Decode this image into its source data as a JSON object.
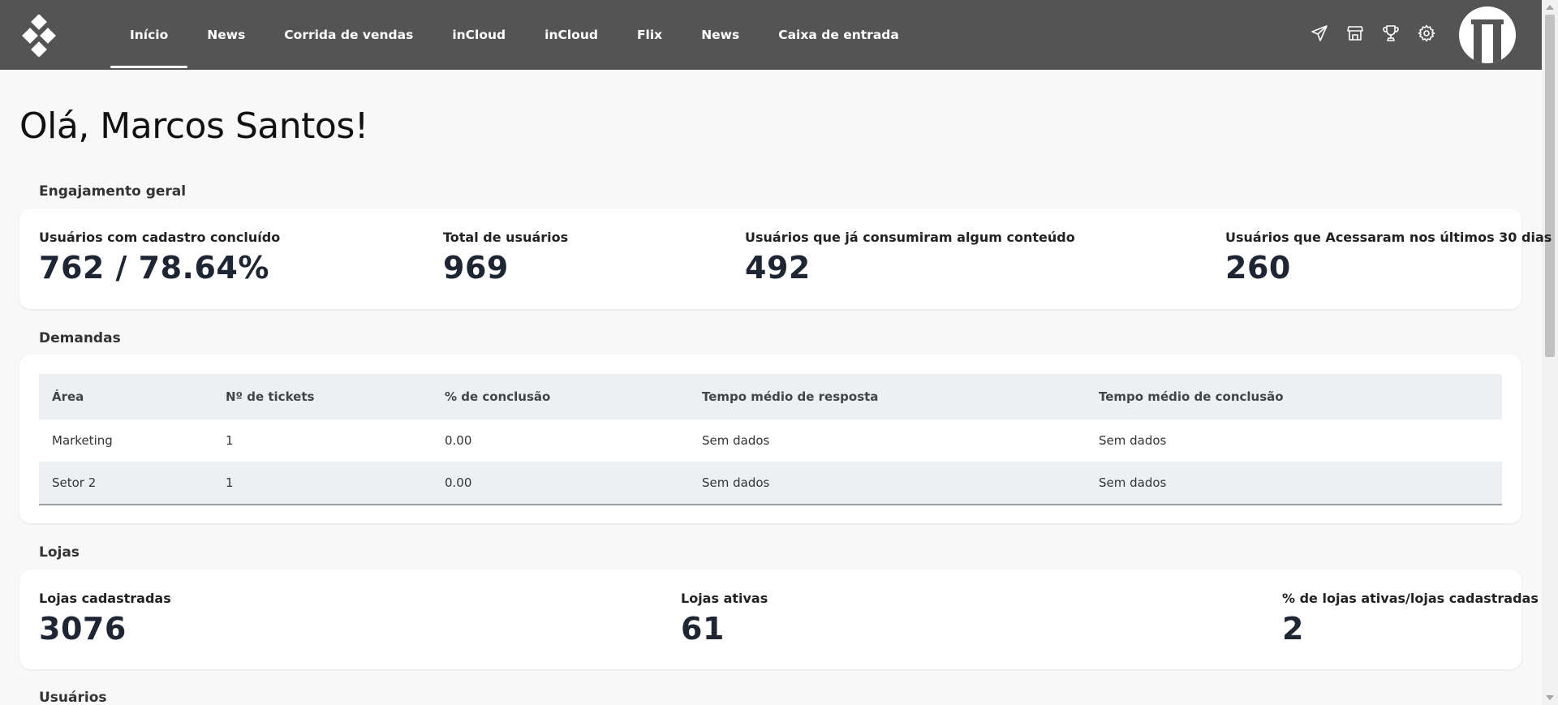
{
  "nav": {
    "items": [
      {
        "label": "Início",
        "active": true
      },
      {
        "label": "News"
      },
      {
        "label": "Corrida de vendas"
      },
      {
        "label": "inCloud"
      },
      {
        "label": "inCloud"
      },
      {
        "label": "Flix"
      },
      {
        "label": "News"
      },
      {
        "label": "Caixa de entrada"
      }
    ],
    "icons": [
      "send-icon",
      "store-icon",
      "trophy-icon",
      "gear-icon"
    ]
  },
  "greeting": "Olá, Marcos Santos!",
  "engagement": {
    "title": "Engajamento geral",
    "stats": [
      {
        "label": "Usuários com cadastro concluído",
        "value": "762 / 78.64%"
      },
      {
        "label": "Total de usuários",
        "value": "969"
      },
      {
        "label": "Usuários que já consumiram algum conteúdo",
        "value": "492"
      },
      {
        "label": "Usuários que Acessaram nos últimos 30 dias",
        "value": "260"
      }
    ]
  },
  "demands": {
    "title": "Demandas",
    "columns": [
      "Área",
      "Nº de tickets",
      "% de conclusão",
      "Tempo médio de resposta",
      "Tempo médio de conclusão"
    ],
    "rows": [
      [
        "Marketing",
        "1",
        "0.00",
        "Sem dados",
        "Sem dados"
      ],
      [
        "Setor 2",
        "1",
        "0.00",
        "Sem dados",
        "Sem dados"
      ]
    ]
  },
  "stores": {
    "title": "Lojas",
    "stats": [
      {
        "label": "Lojas cadastradas",
        "value": "3076"
      },
      {
        "label": "Lojas ativas",
        "value": "61"
      },
      {
        "label": "% de lojas ativas/lojas cadastradas",
        "value": "2"
      }
    ]
  },
  "users": {
    "title": "Usuários"
  },
  "colors": {
    "topbar": "#545454",
    "value_text": "#1e2533",
    "table_header": "#edf0f3"
  }
}
